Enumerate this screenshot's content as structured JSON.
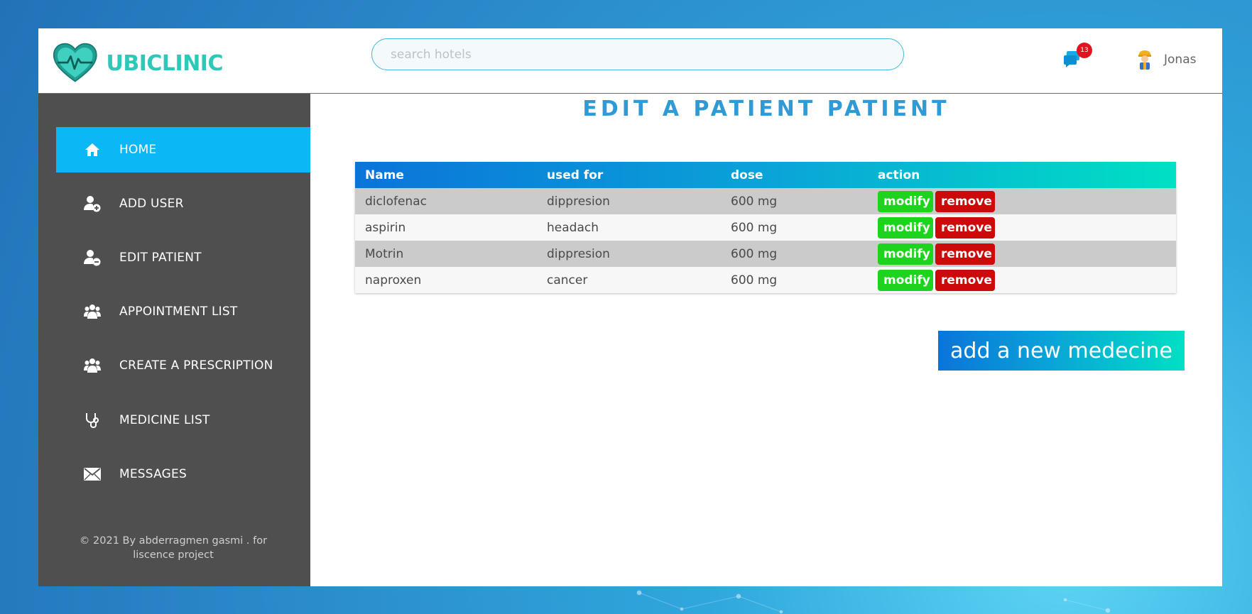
{
  "header": {
    "logo_text": "UBICLINIC",
    "search_placeholder": "search hotels",
    "notification_count": "13",
    "user_name": "Jonas"
  },
  "sidebar": {
    "items": [
      {
        "label": "HOME",
        "icon": "home-icon",
        "active": true
      },
      {
        "label": "ADD USER",
        "icon": "user-plus-icon",
        "active": false
      },
      {
        "label": "EDIT PATIENT",
        "icon": "user-minus-icon",
        "active": false
      },
      {
        "label": "APPOINTMENT LIST",
        "icon": "users-icon",
        "active": false
      },
      {
        "label": "CREATE A PRESCRIPTION",
        "icon": "users-icon",
        "active": false
      },
      {
        "label": "MEDICINE LIST",
        "icon": "stethoscope-icon",
        "active": false
      },
      {
        "label": "MESSAGES",
        "icon": "envelope-icon",
        "active": false
      }
    ],
    "footer_line1": "© 2021 By abderragmen gasmi . for",
    "footer_line2": "liscence project"
  },
  "main": {
    "title": "EDIT A PATIENT PATIENT",
    "table": {
      "columns": [
        "Name",
        "used for",
        "dose",
        "action"
      ],
      "rows": [
        {
          "name": "diclofenac",
          "used_for": "dippresion",
          "dose": "600 mg"
        },
        {
          "name": "aspirin",
          "used_for": "headach",
          "dose": "600 mg"
        },
        {
          "name": "Motrin",
          "used_for": "dippresion",
          "dose": "600 mg"
        },
        {
          "name": "naproxen",
          "used_for": "cancer",
          "dose": "600 mg"
        }
      ],
      "modify_label": "modify",
      "remove_label": "remove"
    },
    "add_button_label": "add a new medecine"
  },
  "colors": {
    "accent": "#0bb8f5",
    "title": "#2f9bd6",
    "modify": "#1ed31e",
    "remove": "#cc0a0a",
    "sidebar": "#4f4f4f",
    "logo": "#2dc8b8"
  }
}
